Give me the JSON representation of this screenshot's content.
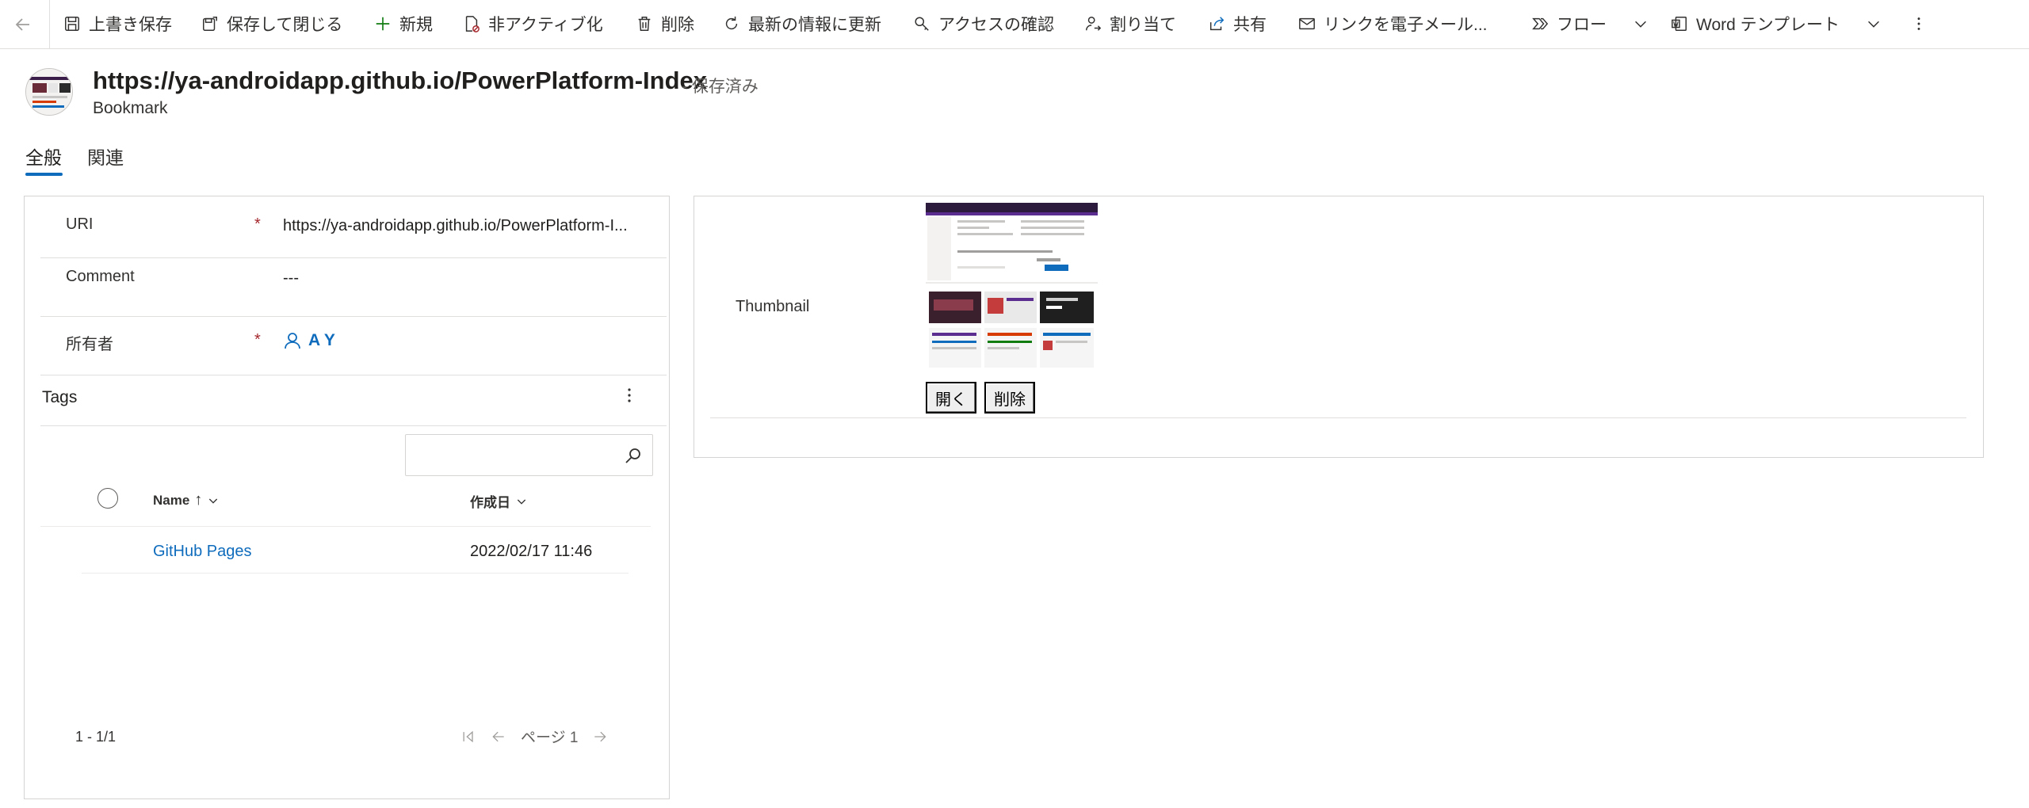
{
  "commandbar": {
    "back_icon": "back-arrow-icon",
    "items": [
      {
        "label": "上書き保存",
        "icon": "save-icon"
      },
      {
        "label": "保存して閉じる",
        "icon": "save-close-icon"
      },
      {
        "label": "新規",
        "icon": "plus-icon"
      },
      {
        "label": "非アクティブ化",
        "icon": "deactivate-icon"
      },
      {
        "label": "削除",
        "icon": "trash-icon"
      },
      {
        "label": "最新の情報に更新",
        "icon": "refresh-icon"
      },
      {
        "label": "アクセスの確認",
        "icon": "key-icon"
      },
      {
        "label": "割り当て",
        "icon": "assign-icon"
      },
      {
        "label": "共有",
        "icon": "share-icon"
      },
      {
        "label": "リンクを電子メール...",
        "icon": "email-link-icon"
      },
      {
        "label": "フロー",
        "icon": "flow-icon"
      },
      {
        "label": "Word テンプレート",
        "icon": "word-icon"
      }
    ],
    "more_icon": "more-vertical-icon"
  },
  "header": {
    "title": "https://ya-androidapp.github.io/PowerPlatform-Index",
    "status": "- 保存済み",
    "entity": "Bookmark"
  },
  "tabs": [
    {
      "label": "全般",
      "active": true
    },
    {
      "label": "関連",
      "active": false
    }
  ],
  "form": {
    "uri": {
      "label": "URI",
      "required": "*",
      "value": "https://ya-androidapp.github.io/PowerPlatform-I..."
    },
    "comment": {
      "label": "Comment",
      "value": "---"
    },
    "owner": {
      "label": "所有者",
      "required": "*",
      "value": "A Y"
    }
  },
  "tags": {
    "title": "Tags",
    "search_placeholder": "",
    "columns": [
      {
        "label": "Name",
        "sort": "↑"
      },
      {
        "label": "作成日"
      }
    ],
    "rows": [
      {
        "name": "GitHub Pages",
        "created": "2022/02/17 11:46"
      }
    ],
    "pager": {
      "count": "1 - 1/1",
      "page_label": "ページ 1"
    }
  },
  "thumbnail": {
    "label": "Thumbnail",
    "open_button": "開く",
    "delete_button": "削除"
  },
  "colors": {
    "accent": "#0f6cbd",
    "required": "#a4262c",
    "border": "#d6d4d2"
  }
}
